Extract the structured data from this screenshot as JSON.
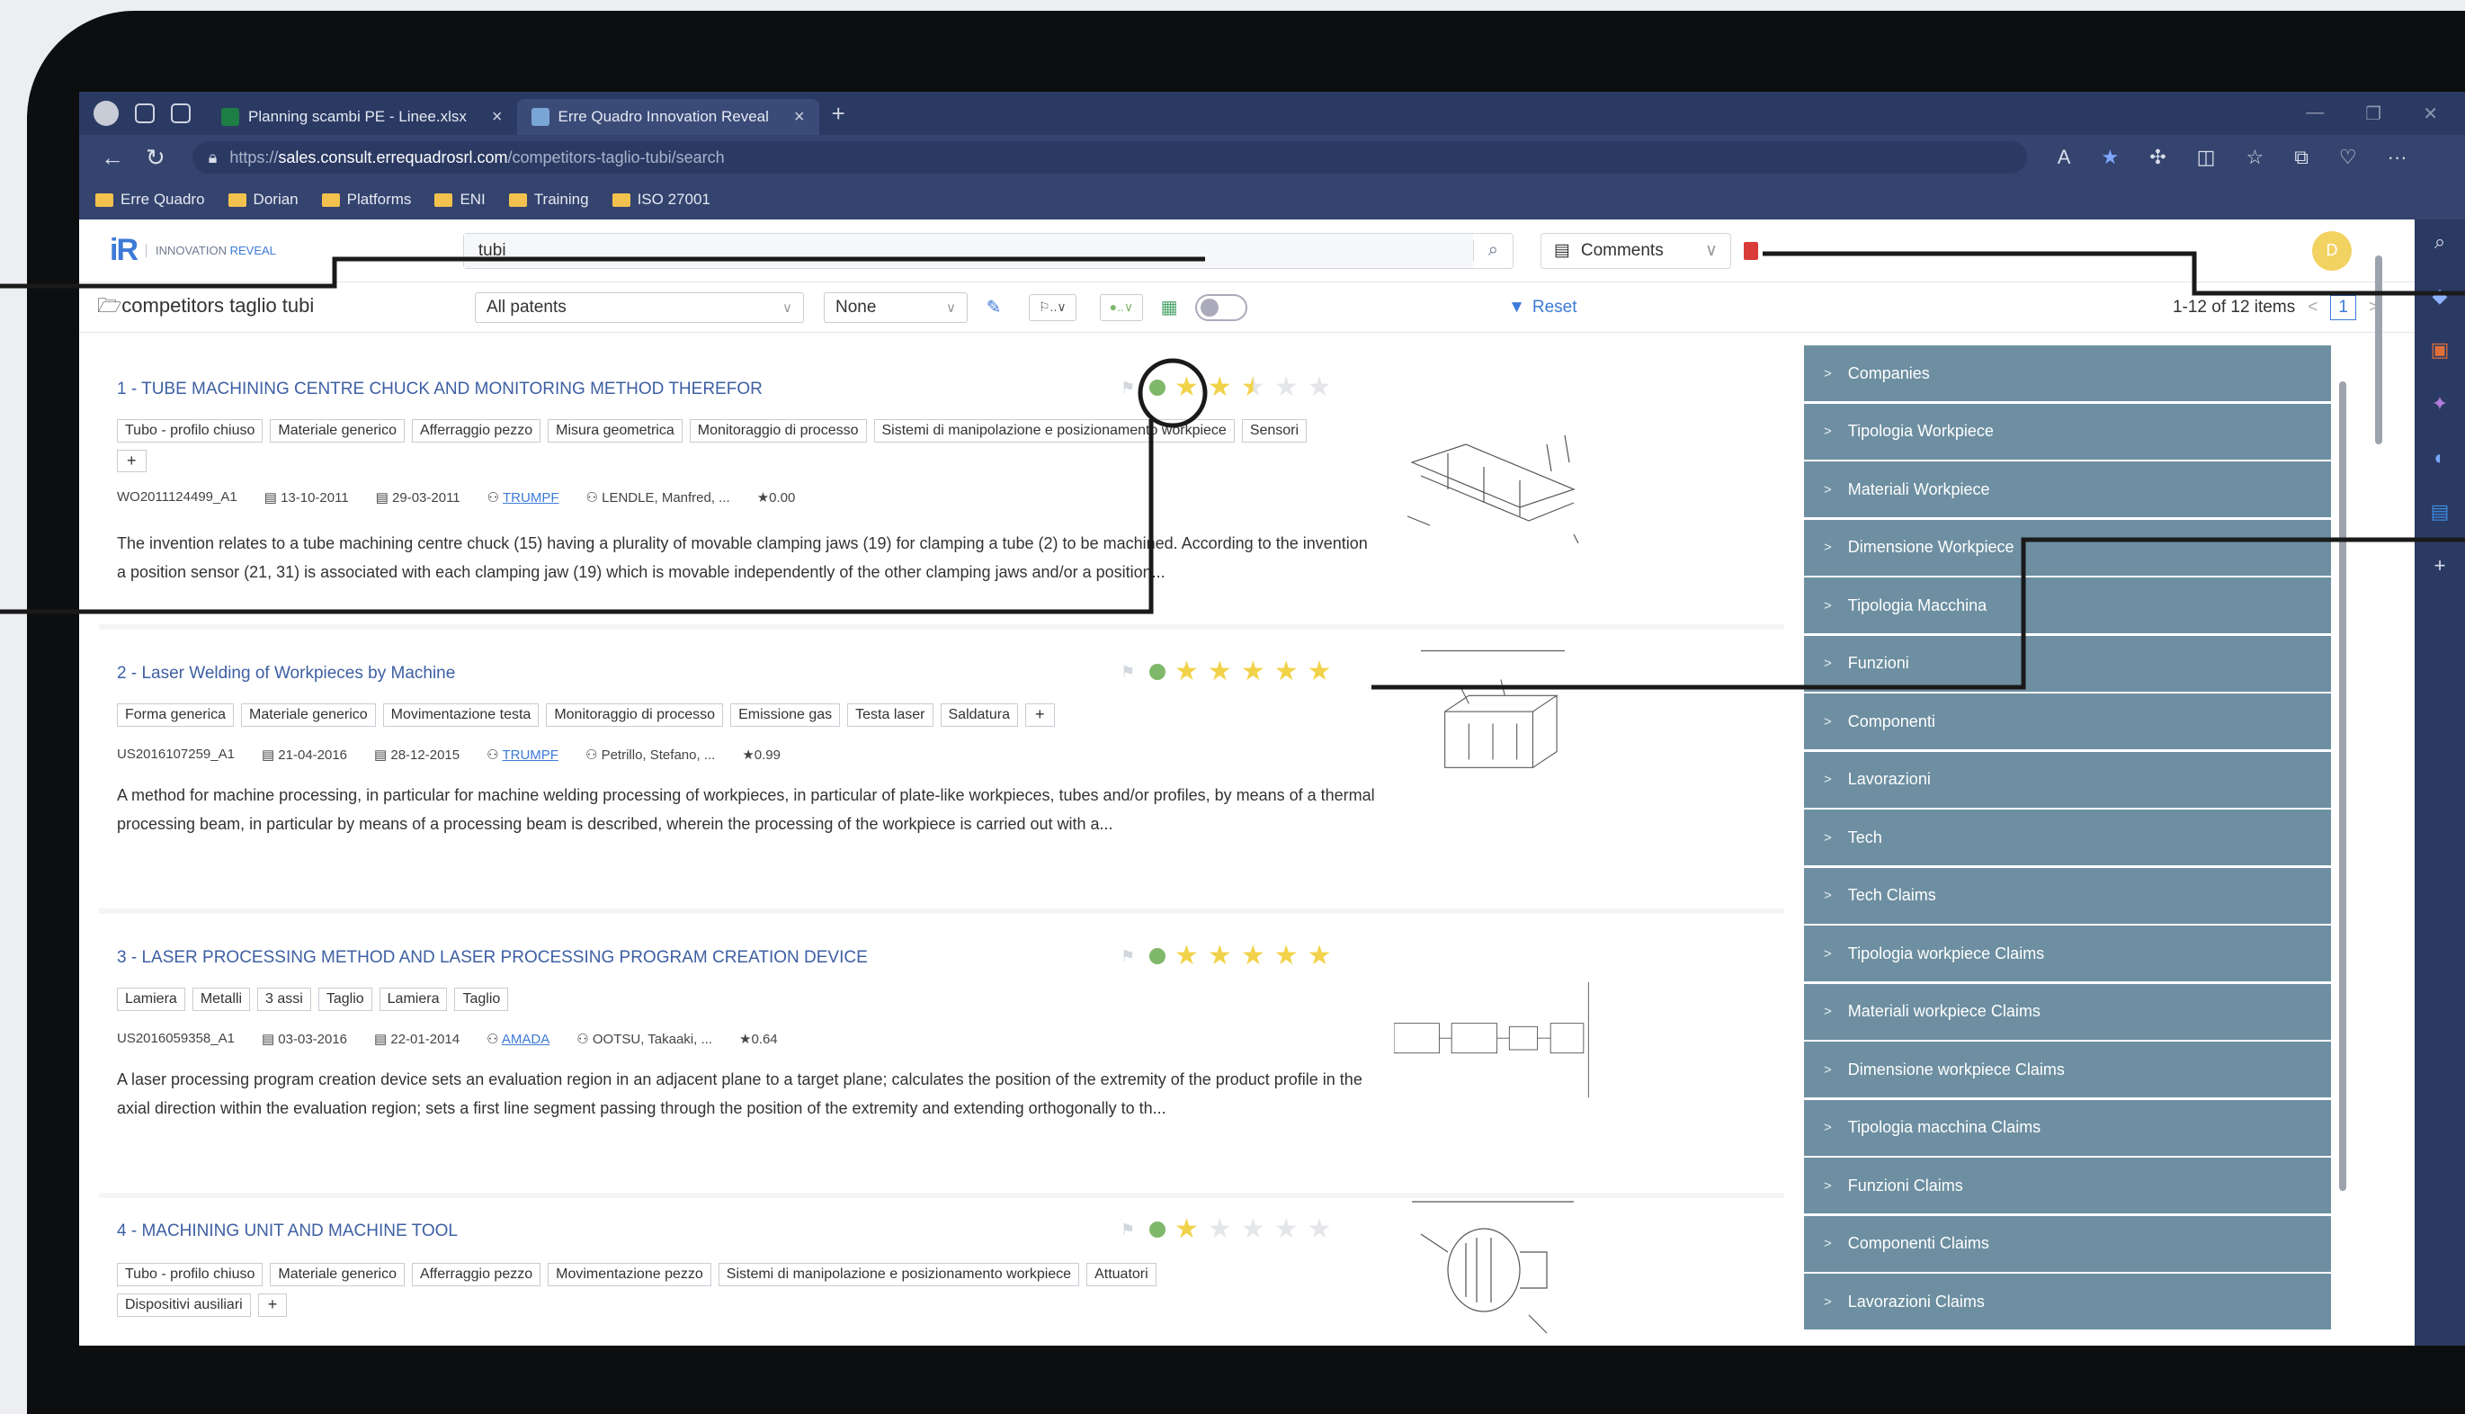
{
  "browser": {
    "tabs": [
      {
        "label": "Planning scambi PE - Linee.xlsx",
        "active": false,
        "favicon_color": "#1e7d45"
      },
      {
        "label": "Erre Quadro Innovation Reveal",
        "active": true,
        "favicon_color": "#7aa6d6"
      }
    ],
    "url_prefix": "https://",
    "url_domain": "sales.consult.errequadrosrl.com",
    "url_path": "/competitors-taglio-tubi/search",
    "bookmarks": [
      "Erre Quadro",
      "Dorian",
      "Platforms",
      "ENI",
      "Training",
      "ISO 27001"
    ]
  },
  "app": {
    "logo_mark": "iR",
    "logo_text_a": "INNOVATION",
    "logo_text_b": "REVEAL",
    "search_value": "tubi",
    "comments_label": "Comments",
    "avatar_initial": "D",
    "project_name": "competitors taglio tubi",
    "filter_patents": "All patents",
    "filter_none": "None",
    "tool_flag": "⚐..∨",
    "tool_dot": "●..∨",
    "reset_label": "Reset",
    "items_count": "1-12 of 12 items",
    "page_number": "1"
  },
  "results": [
    {
      "title": "1 - TUBE MACHINING CENTRE CHUCK AND MONITORING METHOD THEREFOR",
      "stars": 2.5,
      "tags": [
        "Tubo - profilo chiuso",
        "Materiale generico",
        "Afferraggio pezzo",
        "Misura geometrica",
        "Monitoraggio di processo",
        "Sistemi di manipolazione e posizionamento workpiece",
        "Sensori"
      ],
      "pub_number": "WO2011124499_A1",
      "date_1": "13-10-2011",
      "date_2": "29-03-2011",
      "assignee": "TRUMPF",
      "inventors": "LENDLE, Manfred, ...",
      "score": "0.00",
      "abstract": "The invention relates to a tube machining centre chuck (15) having a plurality of movable clamping jaws (19) for clamping a tube (2) to be machined. According to the invention a position sensor (21, 31) is associated with each clamping jaw (19) which is movable independently of the other clamping jaws and/or a position..."
    },
    {
      "title": "2 - Laser Welding of Workpieces by Machine",
      "stars": 5,
      "tags": [
        "Forma generica",
        "Materiale generico",
        "Movimentazione testa",
        "Monitoraggio di processo",
        "Emissione gas",
        "Testa laser",
        "Saldatura"
      ],
      "pub_number": "US2016107259_A1",
      "date_1": "21-04-2016",
      "date_2": "28-12-2015",
      "assignee": "TRUMPF",
      "inventors": "Petrillo, Stefano, ...",
      "score": "0.99",
      "abstract": "A method for machine processing, in particular for machine welding processing of workpieces, in particular of plate-like workpieces, tubes and/or profiles, by means of a thermal processing beam, in particular by means of a processing beam is described, wherein the processing of the workpiece is carried out with a..."
    },
    {
      "title": "3 - LASER PROCESSING METHOD AND LASER PROCESSING PROGRAM CREATION DEVICE",
      "stars": 5,
      "tags": [
        "Lamiera",
        "Metalli",
        "3 assi",
        "Taglio",
        "Lamiera",
        "Taglio"
      ],
      "pub_number": "US2016059358_A1",
      "date_1": "03-03-2016",
      "date_2": "22-01-2014",
      "assignee": "AMADA",
      "inventors": "OOTSU, Takaaki, ...",
      "score": "0.64",
      "abstract": "A laser processing program creation device sets an evaluation region in an adjacent plane to a target plane; calculates the position of the extremity of the product profile in the axial direction within the evaluation region; sets a first line segment passing through the position of the extremity and extending orthogonally to th..."
    },
    {
      "title": "4 - MACHINING UNIT AND MACHINE TOOL",
      "stars": 1,
      "tags": [
        "Tubo - profilo chiuso",
        "Materiale generico",
        "Afferraggio pezzo",
        "Movimentazione pezzo",
        "Sistemi di manipolazione e posizionamento workpiece",
        "Attuatori",
        "Dispositivi ausiliari"
      ],
      "pub_number": "",
      "date_1": "",
      "date_2": "",
      "assignee": "",
      "inventors": "",
      "score": "",
      "abstract": ""
    }
  ],
  "facets": [
    "Companies",
    "Tipologia Workpiece",
    "Materiali Workpiece",
    "Dimensione Workpiece",
    "Tipologia Macchina",
    "Funzioni",
    "Componenti",
    "Lavorazioni",
    "Tech",
    "Tech Claims",
    "Tipologia workpiece Claims",
    "Materiali workpiece Claims",
    "Dimensione workpiece Claims",
    "Tipologia macchina Claims",
    "Funzioni Claims",
    "Componenti Claims",
    "Lavorazioni Claims"
  ],
  "colors": {
    "chrome": "#2b3a63",
    "facet": "#6d8fa1",
    "accent": "#3d7ad8",
    "star": "#f2d24a"
  }
}
